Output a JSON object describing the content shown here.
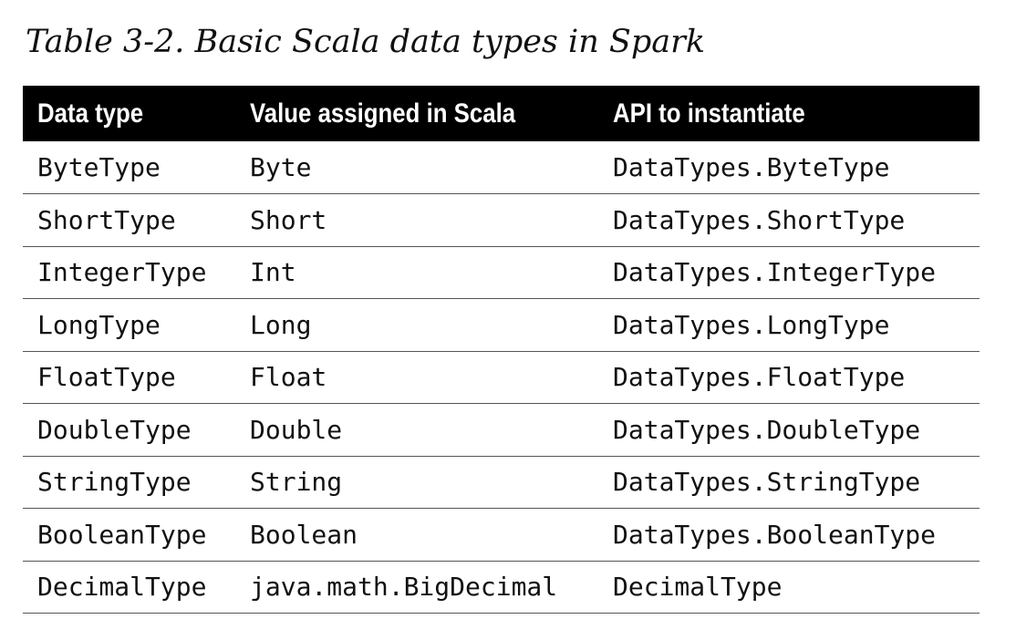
{
  "caption": "Table 3-2. Basic Scala data types in Spark",
  "table": {
    "headers": [
      "Data type",
      "Value assigned in Scala",
      "API to instantiate"
    ],
    "rows": [
      [
        "ByteType",
        "Byte",
        "DataTypes.ByteType"
      ],
      [
        "ShortType",
        "Short",
        "DataTypes.ShortType"
      ],
      [
        "IntegerType",
        "Int",
        "DataTypes.IntegerType"
      ],
      [
        "LongType",
        "Long",
        "DataTypes.LongType"
      ],
      [
        "FloatType",
        "Float",
        "DataTypes.FloatType"
      ],
      [
        "DoubleType",
        "Double",
        "DataTypes.DoubleType"
      ],
      [
        "StringType",
        "String",
        "DataTypes.StringType"
      ],
      [
        "BooleanType",
        "Boolean",
        "DataTypes.BooleanType"
      ],
      [
        "DecimalType",
        "java.math.BigDecimal",
        "DecimalType"
      ]
    ]
  },
  "colors": {
    "header_background": "#000000",
    "header_text": "#ffffff",
    "body_text": "#111111",
    "row_rule": "#555555"
  }
}
